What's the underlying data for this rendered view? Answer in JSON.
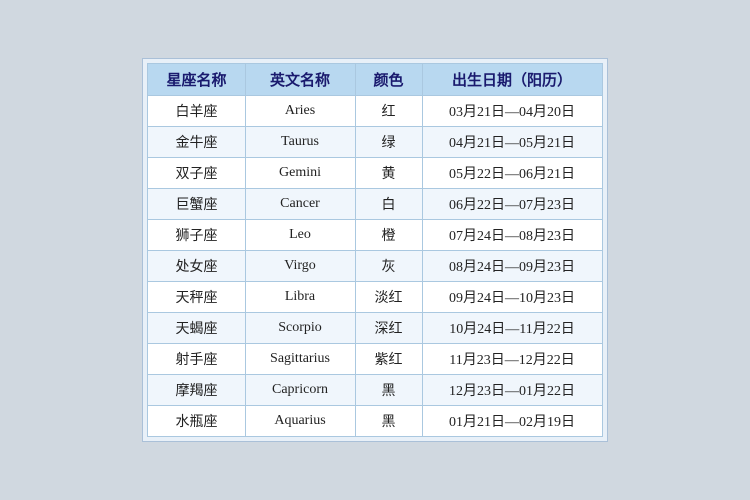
{
  "table": {
    "headers": [
      "星座名称",
      "英文名称",
      "颜色",
      "出生日期（阳历）"
    ],
    "rows": [
      {
        "cn": "白羊座",
        "en": "Aries",
        "color": "红",
        "date": "03月21日—04月20日"
      },
      {
        "cn": "金牛座",
        "en": "Taurus",
        "color": "绿",
        "date": "04月21日—05月21日"
      },
      {
        "cn": "双子座",
        "en": "Gemini",
        "color": "黄",
        "date": "05月22日—06月21日"
      },
      {
        "cn": "巨蟹座",
        "en": "Cancer",
        "color": "白",
        "date": "06月22日—07月23日"
      },
      {
        "cn": "狮子座",
        "en": "Leo",
        "color": "橙",
        "date": "07月24日—08月23日"
      },
      {
        "cn": "处女座",
        "en": "Virgo",
        "color": "灰",
        "date": "08月24日—09月23日"
      },
      {
        "cn": "天秤座",
        "en": "Libra",
        "color": "淡红",
        "date": "09月24日—10月23日"
      },
      {
        "cn": "天蝎座",
        "en": "Scorpio",
        "color": "深红",
        "date": "10月24日—11月22日"
      },
      {
        "cn": "射手座",
        "en": "Sagittarius",
        "color": "紫红",
        "date": "11月23日—12月22日"
      },
      {
        "cn": "摩羯座",
        "en": "Capricorn",
        "color": "黑",
        "date": "12月23日—01月22日"
      },
      {
        "cn": "水瓶座",
        "en": "Aquarius",
        "color": "黑",
        "date": "01月21日—02月19日"
      }
    ]
  }
}
